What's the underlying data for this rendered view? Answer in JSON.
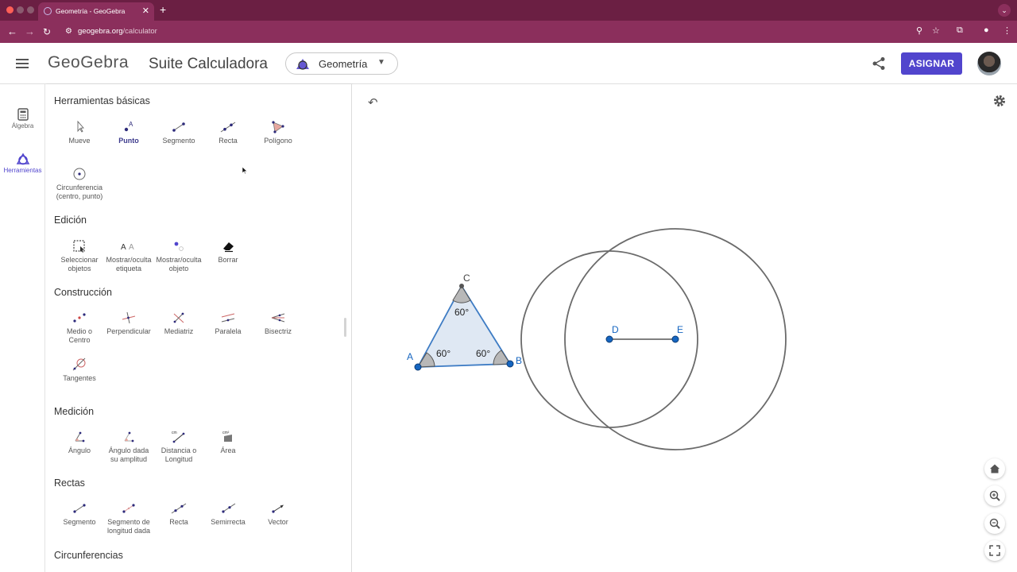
{
  "browser": {
    "tab_title": "Geometría - GeoGebra",
    "url_host": "geogebra.org",
    "url_path": "/calculator"
  },
  "header": {
    "logo": "GeoGebra",
    "suite": "Suite Calculadora",
    "app_selected": "Geometría",
    "assign_label": "ASIGNAR"
  },
  "rail": {
    "algebra": "Álgebra",
    "tools": "Herramientas"
  },
  "panel": {
    "sections": {
      "basic": "Herramientas básicas",
      "edit": "Edición",
      "construct": "Construcción",
      "measure": "Medición",
      "lines": "Rectas",
      "circles": "Circunferencias"
    },
    "basic": [
      "Mueve",
      "Punto",
      "Segmento",
      "Recta",
      "Polígono"
    ],
    "basic2": [
      "Circunferencia",
      "(centro, punto)"
    ],
    "edit": [
      [
        "Seleccionar",
        "objetos"
      ],
      [
        "Mostrar/oculta",
        "etiqueta"
      ],
      [
        "Mostrar/oculta",
        "objeto"
      ],
      [
        "Borrar",
        ""
      ]
    ],
    "construct": [
      [
        "Medio o",
        "Centro"
      ],
      [
        "Perpendicular",
        ""
      ],
      [
        "Mediatriz",
        ""
      ],
      [
        "Paralela",
        ""
      ],
      [
        "Bisectriz",
        ""
      ],
      [
        "Tangentes",
        ""
      ]
    ],
    "measure": [
      [
        "Ángulo",
        ""
      ],
      [
        "Ángulo dada",
        "su amplitud"
      ],
      [
        "Distancia o",
        "Longitud"
      ],
      [
        "Área",
        ""
      ]
    ],
    "lines": [
      [
        "Segmento",
        ""
      ],
      [
        "Segmento de",
        "longitud dada"
      ],
      [
        "Recta",
        ""
      ],
      [
        "Semirrecta",
        ""
      ],
      [
        "Vector",
        ""
      ]
    ]
  },
  "canvas": {
    "points": {
      "A": "A",
      "B": "B",
      "C": "C",
      "D": "D",
      "E": "E"
    },
    "angle_a": "60°",
    "angle_b": "60°",
    "angle_c": "60°"
  },
  "colors": {
    "accent": "#5145cd",
    "chrome_tabbar": "#6b1f43",
    "chrome_addr": "#8b2f5c",
    "point_blue": "#1565c0",
    "triangle_fill": "#dfe8f3",
    "circle_stroke": "#6b6b6b"
  }
}
